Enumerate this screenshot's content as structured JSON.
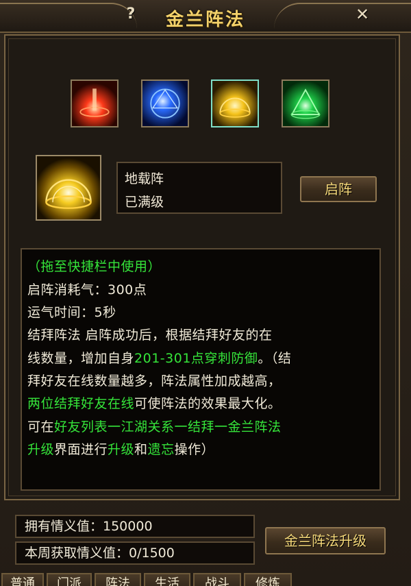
{
  "window": {
    "title": "金兰阵法",
    "help_label": "?",
    "close_label": "✕"
  },
  "formations": [
    {
      "name": "fire-formation-icon",
      "color": "#ff3a1a"
    },
    {
      "name": "blue-formation-icon",
      "color": "#2a6cff"
    },
    {
      "name": "gold-formation-icon",
      "color": "#f4c21a",
      "selected": true
    },
    {
      "name": "green-formation-icon",
      "color": "#1fd24a"
    }
  ],
  "selected": {
    "name": "地载阵",
    "status": "已满级",
    "activate_label": "启阵"
  },
  "description": {
    "usage": "（拖至快捷栏中使用）",
    "cost": "启阵消耗气：300点",
    "duration": "运气时间：5秒",
    "l4": "结拜阵法  启阵成功后，根据结拜好友的在",
    "l5a": "线数量，增加自身",
    "l5b": "201-301点穿刺防御",
    "l5c": "。（结",
    "l6": "拜好友在线数量越多，阵法属性加成越高，",
    "l7a": "两位结拜好友在线",
    "l7b": "可使阵法的效果最大化。",
    "l8a": "可在",
    "l8b": "好友列表一江湖关系一结拜一金兰阵法",
    "l9a": "升级",
    "l9b": "界面进行",
    "l9c": "升级",
    "l9d": "和",
    "l9e": "遗忘",
    "l9f": "操作）"
  },
  "stats": {
    "owned": "拥有情义值：150000",
    "weekly": "本周获取情义值：0/1500"
  },
  "upgrade_label": "金兰阵法升级",
  "tabs": [
    "普通",
    "门派",
    "阵法",
    "生活",
    "战斗",
    "修炼"
  ],
  "colors": {
    "accent": "#f4d26a",
    "highlight": "#35e43a",
    "border": "#7a6544"
  }
}
